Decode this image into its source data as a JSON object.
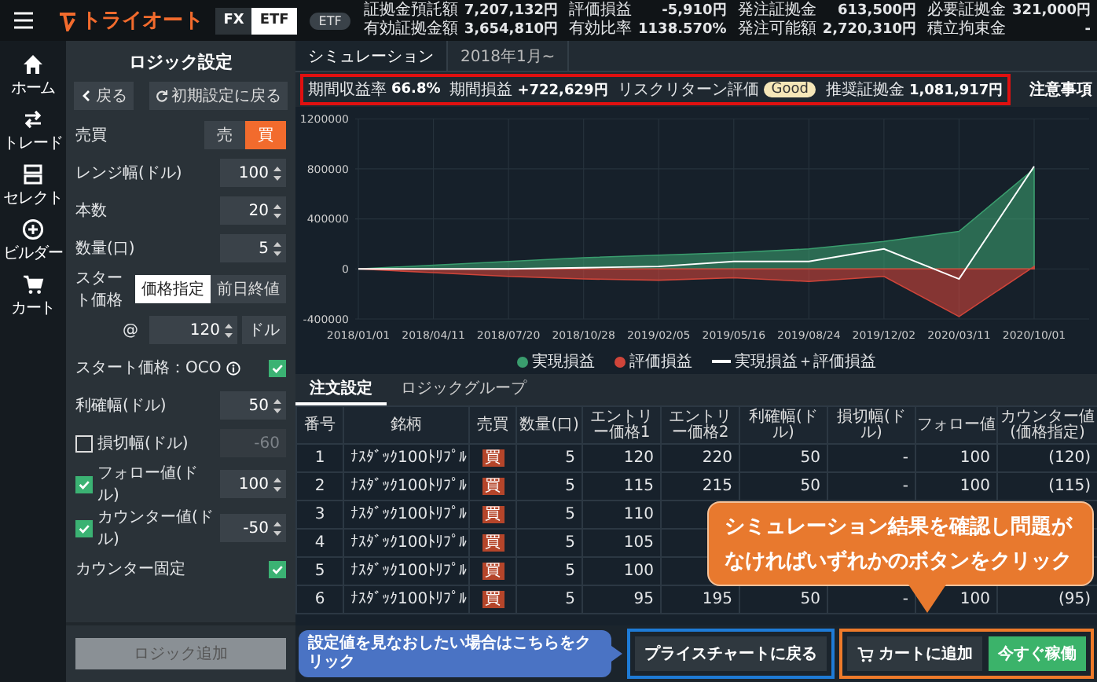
{
  "header": {
    "logo": "トライオート",
    "market_tabs": [
      {
        "label": "FX",
        "selected": false
      },
      {
        "label": "ETF",
        "selected": true
      }
    ],
    "badge": "ETF",
    "account": [
      {
        "label": "証拠金預託額",
        "value": "7,207,132円"
      },
      {
        "label": "評価損益",
        "value": "-5,910円"
      },
      {
        "label": "発注証拠金",
        "value": "613,500円"
      },
      {
        "label": "必要証拠金",
        "value": "321,000円"
      },
      {
        "label": "有効証拠金額",
        "value": "3,654,810円"
      },
      {
        "label": "有効比率",
        "value": "1138.570%"
      },
      {
        "label": "発注可能額",
        "value": "2,720,310円"
      },
      {
        "label": "積立拘束金",
        "value": "-"
      }
    ]
  },
  "nav": [
    {
      "kind": "home",
      "label": "ホーム"
    },
    {
      "kind": "trade",
      "label": "トレード"
    },
    {
      "kind": "select",
      "label": "セレクト"
    },
    {
      "kind": "builder",
      "label": "ビルダー"
    },
    {
      "kind": "cart",
      "label": "カート"
    }
  ],
  "logic_panel": {
    "title": "ロジック設定",
    "back_button": "戻る",
    "reset_button": "初期設定に戻る",
    "rows": [
      {
        "kind": "side_toggle",
        "label": "売買",
        "options": [
          {
            "label": "売",
            "selected": false
          },
          {
            "label": "買",
            "selected": true
          }
        ]
      },
      {
        "kind": "number",
        "label": "レンジ幅(ドル)",
        "value": "100"
      },
      {
        "kind": "number",
        "label": "本数",
        "value": "20"
      },
      {
        "kind": "number",
        "label": "数量(口)",
        "value": "5"
      },
      {
        "kind": "toggle",
        "label": "スタート価格",
        "options": [
          {
            "label": "価格指定",
            "selected": true
          },
          {
            "label": "前日終値",
            "selected": false
          }
        ]
      },
      {
        "kind": "price",
        "prefix": "@",
        "value": "120",
        "unit": "ドル"
      },
      {
        "kind": "check",
        "label": "スタート価格：OCO",
        "info": true,
        "checked": true
      },
      {
        "kind": "number",
        "label": "利確幅(ドル)",
        "value": "50"
      },
      {
        "kind": "checked_number",
        "label": "損切幅(ドル)",
        "checked": false,
        "value": "-60"
      },
      {
        "kind": "checked_number",
        "label": "フォロー値(ドル)",
        "checked": true,
        "value": "100"
      },
      {
        "kind": "checked_number",
        "label": "カウンター値(ドル)",
        "checked": true,
        "value": "-50"
      },
      {
        "kind": "check",
        "label": "カウンター固定",
        "info": false,
        "checked": true
      }
    ],
    "add_button": {
      "label": "ロジック追加",
      "disabled": true
    }
  },
  "sim_tabs": [
    {
      "label": "シミュレーション",
      "selected": true
    },
    {
      "label": "2018年1月~",
      "selected": false
    }
  ],
  "summary": {
    "items": [
      {
        "kind": "value",
        "label": "期間収益率",
        "value": "66.8%"
      },
      {
        "kind": "value",
        "label": "期間損益",
        "value": "+722,629円"
      },
      {
        "kind": "badge",
        "label": "リスクリターン評価",
        "value": "Good"
      },
      {
        "kind": "value",
        "label": "推奨証拠金",
        "value": "1,081,917円"
      }
    ],
    "notice_link": "注意事項"
  },
  "chart": {
    "chart_data": {
      "type": "area",
      "categories": [
        "2018/01/01",
        "2018/04/11",
        "2018/07/20",
        "2018/10/28",
        "2019/02/05",
        "2019/05/16",
        "2019/08/24",
        "2019/12/02",
        "2020/03/11",
        "2020/10/01"
      ],
      "series": [
        {
          "name": "実現損益",
          "type": "area",
          "color": "#3a9d6e",
          "values": [
            0,
            30000,
            60000,
            90000,
            110000,
            130000,
            160000,
            220000,
            300000,
            800000
          ]
        },
        {
          "name": "評価損益",
          "type": "area",
          "color": "#d0453a",
          "values": [
            0,
            -30000,
            -60000,
            -80000,
            -90000,
            -70000,
            -100000,
            -60000,
            -380000,
            20000
          ]
        },
        {
          "name": "実現損益＋評価損益",
          "type": "line",
          "color": "#ffffff",
          "values": [
            0,
            0,
            0,
            10000,
            20000,
            60000,
            60000,
            160000,
            -80000,
            820000
          ]
        }
      ],
      "yticks": [
        1200000,
        800000,
        400000,
        0,
        -400000
      ],
      "ylim": [
        -400000,
        1200000
      ],
      "grid": true,
      "legend": "bottom"
    }
  },
  "order_tabs": [
    {
      "label": "注文設定",
      "selected": true
    },
    {
      "label": "ロジックグループ",
      "selected": false
    }
  ],
  "table": {
    "columns": [
      "番号",
      "銘柄",
      "売買",
      "数量(口)",
      "エントリー価格1",
      "エントリー価格2",
      "利確幅(ドル)",
      "損切幅(ドル)",
      "フォロー値",
      "カウンター値(価格指定)"
    ],
    "rows": [
      {
        "cells": [
          "1",
          "ﾅｽﾀﾞｯｸ100ﾄﾘﾌﾟﾙ",
          "買",
          "5",
          "120",
          "220",
          "50",
          "-",
          "100",
          "(120)"
        ]
      },
      {
        "cells": [
          "2",
          "ﾅｽﾀﾞｯｸ100ﾄﾘﾌﾟﾙ",
          "買",
          "5",
          "115",
          "215",
          "50",
          "-",
          "100",
          "(115)"
        ]
      },
      {
        "cells": [
          "3",
          "ﾅｽﾀﾞｯｸ100ﾄﾘﾌﾟﾙ",
          "買",
          "5",
          "110"
        ]
      },
      {
        "cells": [
          "4",
          "ﾅｽﾀﾞｯｸ100ﾄﾘﾌﾟﾙ",
          "買",
          "5",
          "105"
        ]
      },
      {
        "cells": [
          "5",
          "ﾅｽﾀﾞｯｸ100ﾄﾘﾌﾟﾙ",
          "買",
          "5",
          "100"
        ]
      },
      {
        "cells": [
          "6",
          "ﾅｽﾀﾞｯｸ100ﾄﾘﾌﾟﾙ",
          "買",
          "5",
          "95",
          "195",
          "50",
          "-",
          "100",
          "(95)"
        ]
      }
    ]
  },
  "callout": "シミュレーション結果を確認し問題がなければいずれかのボタンをクリック",
  "hint_callout": "設定値を見なおしたい場合はこちらをクリック",
  "actions": [
    {
      "kind": "back",
      "label": "プライスチャートに戻る"
    },
    {
      "kind": "cart",
      "label": "カートに追加"
    },
    {
      "kind": "start",
      "label": "今すぐ稼働"
    }
  ]
}
